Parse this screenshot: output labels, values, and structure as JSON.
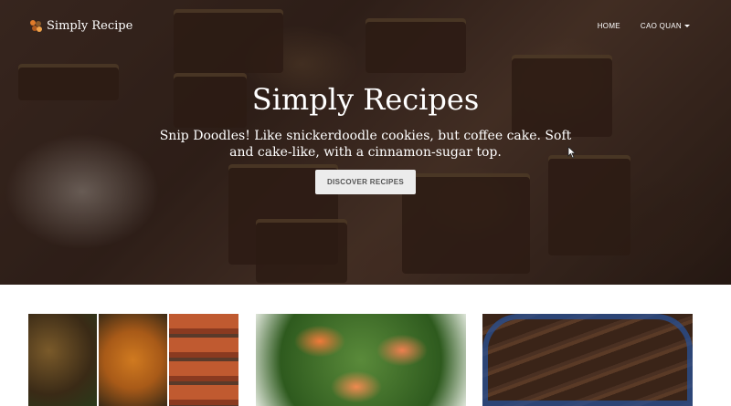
{
  "brand": {
    "name": "Simply Recipe",
    "logo_icon": "spoon-fork-logo-icon"
  },
  "nav": {
    "home": "HOME",
    "user": "CAO QUAN"
  },
  "hero": {
    "title": "Simply Recipes",
    "subtitle": "Snip Doodles! Like snickerdoodle cookies, but coffee cake. Soft and cake-like, with a cinnamon-sugar top.",
    "button": "DISCOVER RECIPES"
  },
  "cards": [
    {
      "image": "roasted-vegetables-collage"
    },
    {
      "image": "salmon-salad"
    },
    {
      "image": "chocolate-biscotti"
    }
  ],
  "colors": {
    "hero_overlay": "#2e1f18",
    "button_bg": "#ececec",
    "button_text": "#555555",
    "nav_text": "#ffffff"
  }
}
